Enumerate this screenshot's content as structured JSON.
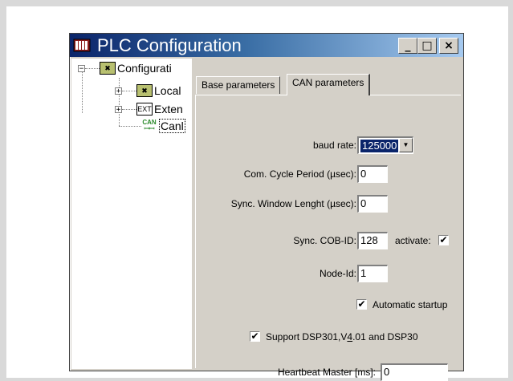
{
  "window": {
    "title": "PLC Configuration",
    "buttons": {
      "minimize": "_",
      "maximize": "□",
      "close": "×"
    }
  },
  "tree": {
    "items": [
      {
        "label": "Configurati",
        "icon": "configuration-icon",
        "expander": "⊟"
      },
      {
        "label": "Local",
        "icon": "local-module-icon",
        "expander": "⊞"
      },
      {
        "label": "Exten",
        "icon": "ext-module-icon",
        "icon_text": "EXT",
        "expander": "⊞"
      },
      {
        "label": "Canl",
        "icon": "can-master-icon",
        "icon_text": "CAN"
      }
    ]
  },
  "tabs": [
    {
      "label": "Base parameters",
      "active": false
    },
    {
      "label": "CAN parameters",
      "active": true
    }
  ],
  "can": {
    "baud_rate_label": "baud rate:",
    "baud_rate_value": "125000",
    "com_cycle_label": "Com. Cycle Period (µsec):",
    "com_cycle_value": "0",
    "sync_window_label": "Sync. Window Lenght (µsec):",
    "sync_window_value": "0",
    "sync_cob_label": "Sync. COB-ID:",
    "sync_cob_value": "128",
    "activate_label": "activate:",
    "activate_checked": "✔",
    "node_id_label": "Node-Id:",
    "node_id_value": "1",
    "auto_startup_label": "Automatic startup",
    "auto_startup_checked": "✔",
    "support_pre": "Support DSP301,V",
    "support_ul": "4",
    "support_post": ".01 and DSP30",
    "support_checked": "✔",
    "heartbeat_label": "Heartbeat Master [ms]:",
    "heartbeat_value": "0"
  }
}
